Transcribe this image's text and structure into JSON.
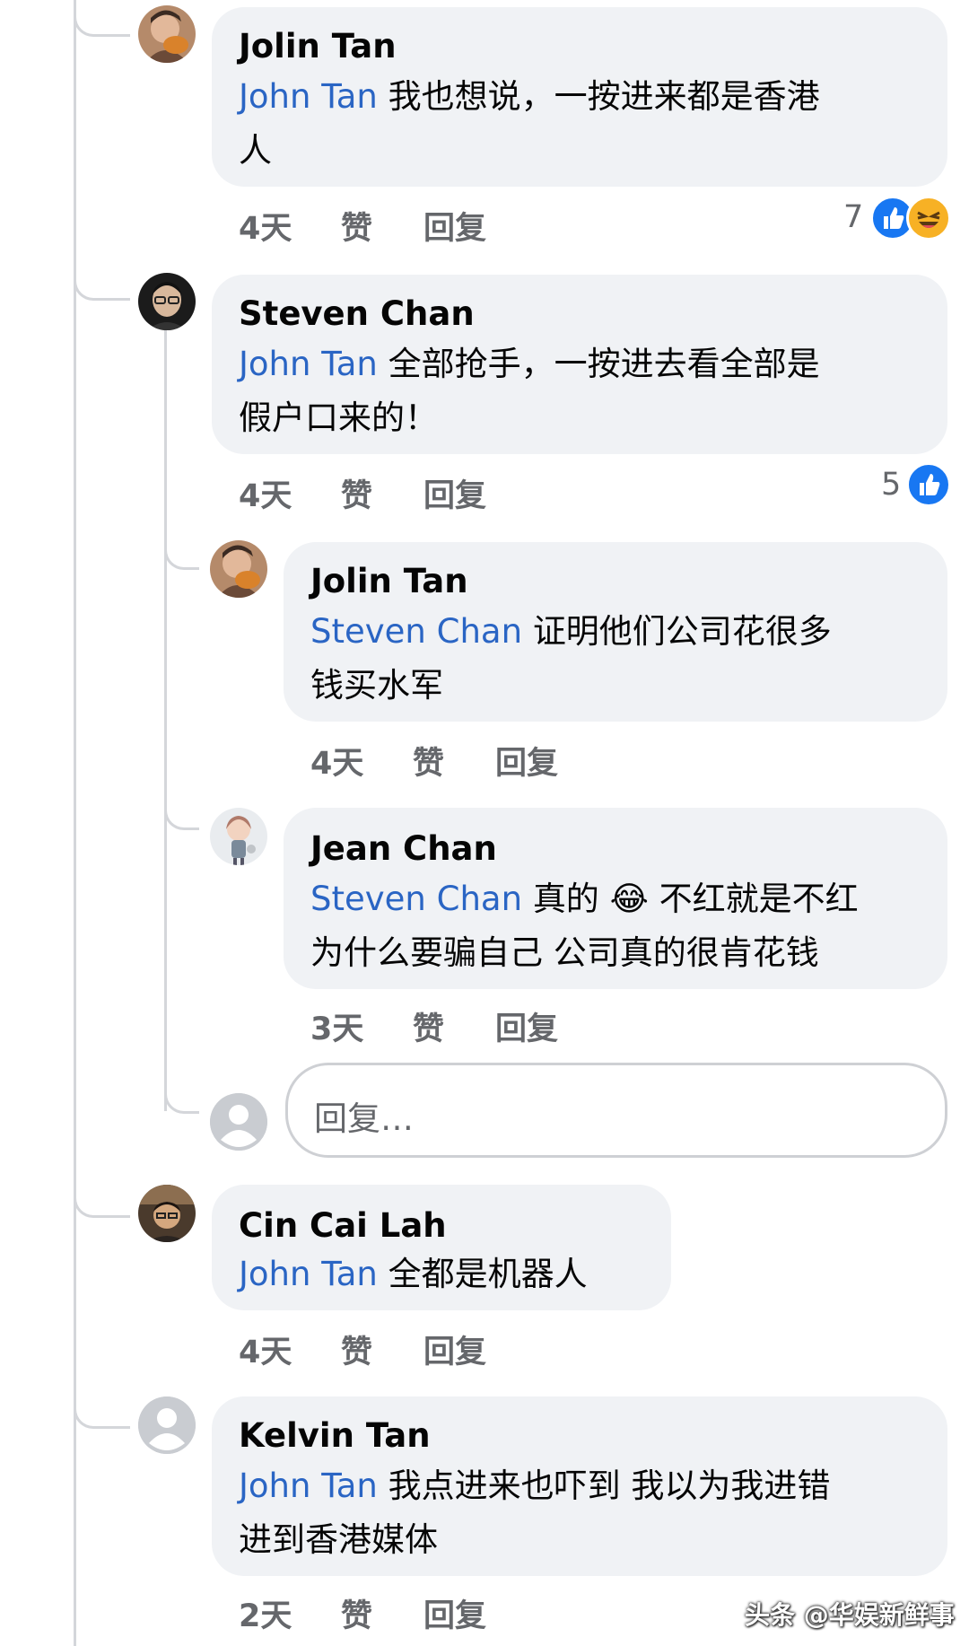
{
  "comments": [
    {
      "author": "Jolin Tan",
      "mention": "John Tan",
      "text_line1": "我也想说，一按进来都是香港",
      "text_line2": "人",
      "time": "4天",
      "like": "赞",
      "reply": "回复",
      "reaction_count": "7",
      "reactions": [
        "like-icon",
        "haha-icon"
      ]
    },
    {
      "author": "Steven Chan",
      "mention": "John Tan",
      "text_line1": "全部抢手，一按进去看全部是",
      "text_line2": "假户口来的！",
      "time": "4天",
      "like": "赞",
      "reply": "回复",
      "reaction_count": "5",
      "reactions": [
        "like-icon"
      ],
      "replies": [
        {
          "author": "Jolin Tan",
          "mention": "Steven Chan",
          "text_line1": "证明他们公司花很多",
          "text_line2": "钱买水军",
          "time": "4天",
          "like": "赞",
          "reply": "回复"
        },
        {
          "author": "Jean Chan",
          "mention": "Steven Chan",
          "text_line1a": "真的",
          "emoji": "😂",
          "text_line1b": "不红就是不红",
          "text_line2": "为什么要骗自己 公司真的很肯花钱",
          "time": "3天",
          "like": "赞",
          "reply": "回复"
        }
      ],
      "reply_input_placeholder": "回复…"
    },
    {
      "author": "Cin Cai Lah",
      "mention": "John Tan",
      "text_line1": "全都是机器人",
      "time": "4天",
      "like": "赞",
      "reply": "回复"
    },
    {
      "author": "Kelvin Tan",
      "mention": "John Tan",
      "text_line1": "我点进来也吓到 我以为我进错",
      "text_line2": "进到香港媒体",
      "time": "2天",
      "like": "赞",
      "reply": "回复"
    }
  ],
  "watermark": "头条 @华娱新鲜事",
  "colors": {
    "bubble": "#f0f2f5",
    "mention": "#2a65c4",
    "meta": "#65676b",
    "like_blue": "#1877f2",
    "haha_yellow": "#f7b125"
  }
}
